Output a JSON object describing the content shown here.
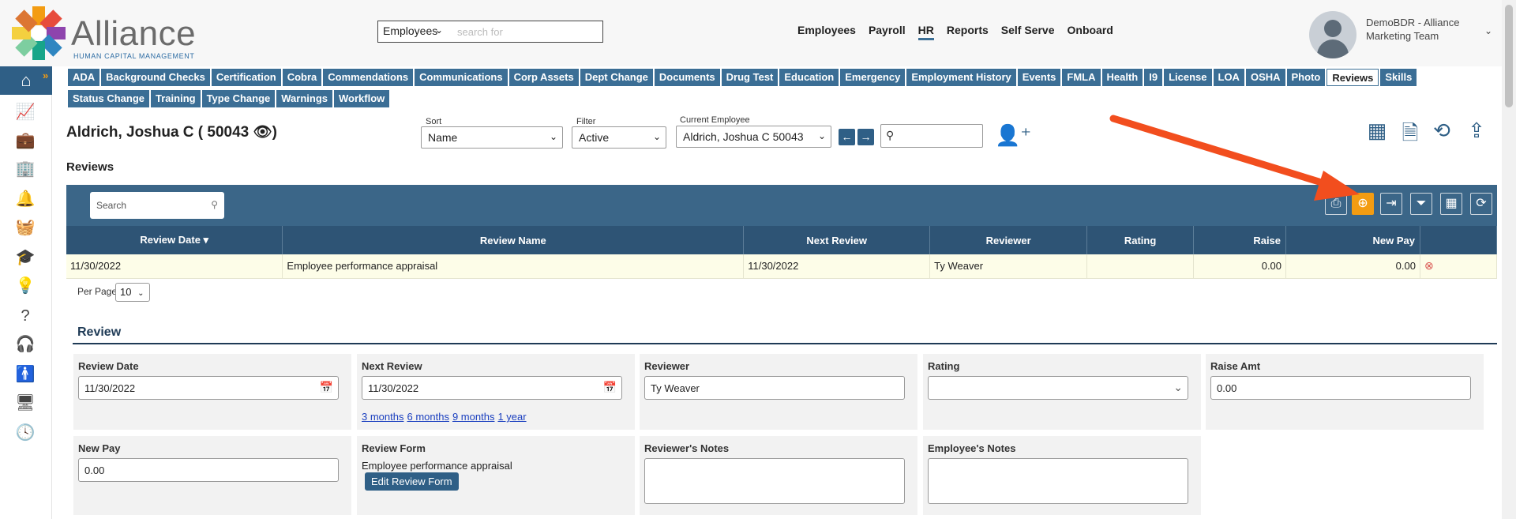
{
  "header": {
    "brand": "Alliance",
    "brand_tag": "HUMAN CAPITAL MANAGEMENT",
    "search_scope": "Employees",
    "search_placeholder": "search for",
    "nav": [
      "Employees",
      "Payroll",
      "HR",
      "Reports",
      "Self Serve",
      "Onboard"
    ],
    "nav_active": "HR",
    "user_line1": "DemoBDR - Alliance",
    "user_line2": "Marketing Team"
  },
  "tabs": [
    "ADA",
    "Background Checks",
    "Certification",
    "Cobra",
    "Commendations",
    "Communications",
    "Corp Assets",
    "Dept Change",
    "Documents",
    "Drug Test",
    "Education",
    "Emergency",
    "Employment History",
    "Events",
    "FMLA",
    "Health",
    "I9",
    "License",
    "LOA",
    "OSHA",
    "Photo",
    "Reviews",
    "Skills",
    "Status Change",
    "Training",
    "Type Change",
    "Warnings",
    "Workflow"
  ],
  "active_tab": "Reviews",
  "employee": {
    "name": "Aldrich, Joshua C ( 50043",
    "close_paren": ")",
    "sort_label": "Sort",
    "sort_value": "Name",
    "filter_label": "Filter",
    "filter_value": "Active",
    "current_label": "Current Employee",
    "current_value": "Aldrich, Joshua C 50043"
  },
  "section_title": "Reviews",
  "grid": {
    "search_placeholder": "Search",
    "columns": [
      "Review Date",
      "Review Name",
      "Next Review",
      "Reviewer",
      "Rating",
      "Raise",
      "New Pay"
    ],
    "rows": [
      [
        "11/30/2022",
        "Employee performance appraisal",
        "11/30/2022",
        "Ty Weaver",
        "",
        "0.00",
        "0.00"
      ]
    ],
    "per_page_label": "Per Page",
    "per_page_value": "10"
  },
  "review": {
    "title": "Review",
    "review_date_label": "Review Date",
    "review_date": "11/30/2022",
    "next_review_label": "Next Review",
    "next_review": "11/30/2022",
    "next_links": [
      "3 months",
      "6 months",
      "9 months",
      "1 year"
    ],
    "reviewer_label": "Reviewer",
    "reviewer": "Ty Weaver",
    "rating_label": "Rating",
    "rating": "",
    "raise_label": "Raise Amt",
    "raise": "0.00",
    "new_pay_label": "New Pay",
    "new_pay": "0.00",
    "form_label": "Review Form",
    "form_name": "Employee performance appraisal",
    "edit_form_button": "Edit Review Form",
    "reviewer_notes_label": "Reviewer's Notes",
    "employee_notes_label": "Employee's Notes"
  },
  "colors": {
    "primary": "#3b6e95",
    "header_dark": "#2e5475",
    "accent": "#f39c12",
    "annotation_arrow": "#f24e1e"
  }
}
